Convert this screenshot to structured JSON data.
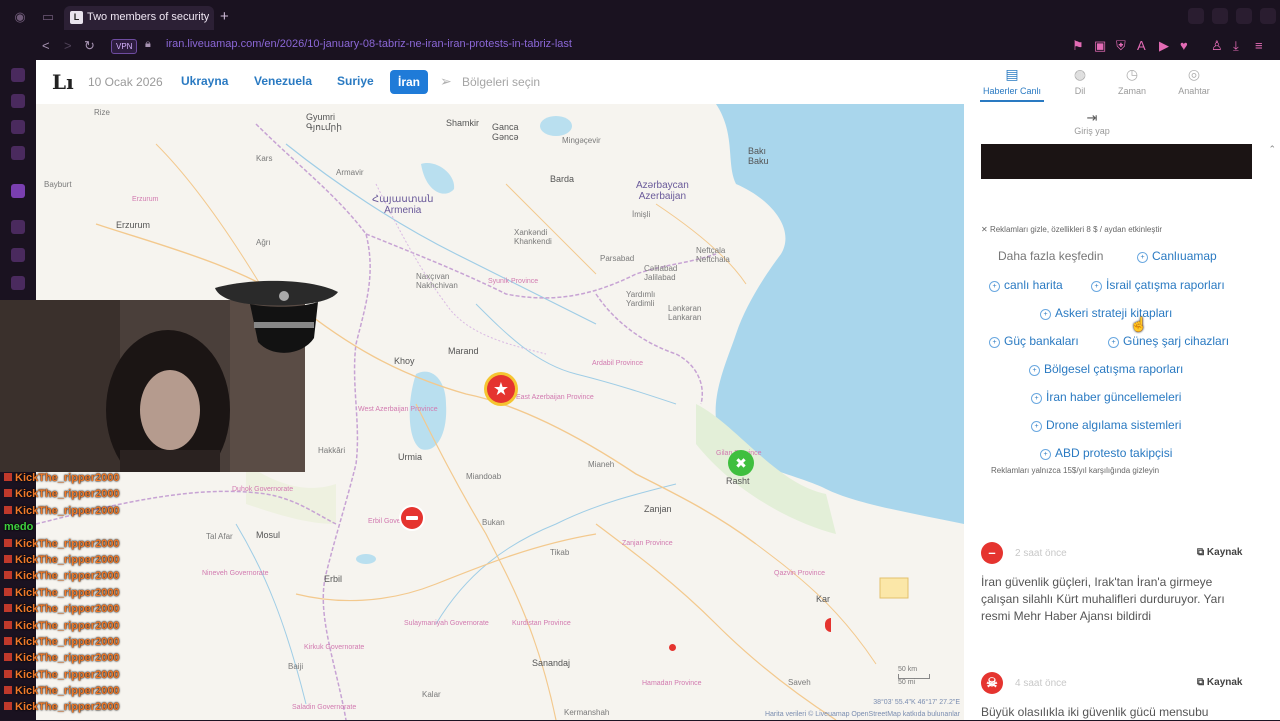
{
  "browser": {
    "tab_title": "Two members of security",
    "new_tab": "+",
    "vpn_label": "VPN",
    "url": "iran.liveuamap.com/en/2026/10-january-08-tabriz-ne-iran-iran-protests-in-tabriz-last"
  },
  "site": {
    "logo": "Lı",
    "date": "10 Ocak 2026",
    "nav": [
      "Ukrayna",
      "Venezuela",
      "Suriye"
    ],
    "nav_active": "İran",
    "region_select": "Bölgeleri seçin"
  },
  "map": {
    "labels": {
      "rize": "Rize",
      "gyumri": "Gyumri\nԳյումրի",
      "shamkir": "Shamkir",
      "ganca": "Ganca\nGəncə",
      "mingachevir": "Mingəçevir",
      "kars": "Kars",
      "baku": "Bakı\nBaku",
      "armavir": "Armavir",
      "armenia": "Հայաստան\nArmenia",
      "barda": "Barda",
      "azerbaijan": "Azərbaycan\nAzerbaijan",
      "bayburt": "Bayburt",
      "erzurum_p": "Erzurum",
      "erzurum": "Erzurum",
      "imisli": "İmişli",
      "agri": "Ağrı",
      "xankendi": "Xankəndi\nKhankendi",
      "nakhchivan": "Naxçıvan\nNakhchivan",
      "parsabad": "Parsabad",
      "celilabad": "Cəlilabad\nJalilabad",
      "neftcala": "Neftçala\nNeftchala",
      "syunik": "Syunik Province",
      "lankaran": "Lənkəran\nLankaran",
      "yardimli": "Yardımlı\nYardimli",
      "marand": "Marand",
      "khoy": "Khoy",
      "ardabil": "Ardabil Province",
      "east_az": "East Azerbaijan Province",
      "west_az": "West Azerbaijan Province",
      "urmia": "Urmia",
      "hakkari": "Hakkâri",
      "gilan": "Gilan Province",
      "rasht": "Rasht",
      "mianeh": "Mianeh",
      "miandoab": "Miandoab",
      "zanjan": "Zanjan",
      "zanjan_p": "Zanjan Province",
      "duhok": "Duhok Governorate",
      "erbil_g": "Erbil Governorate",
      "mosul": "Mosul",
      "talafar": "Tal Afar",
      "bukan": "Bukan",
      "takab": "Tikab",
      "erbil": "Erbil",
      "nineveh": "Nineveh Governorate",
      "qazvin": "Qazvin Province",
      "kurdistan": "Kurdistan Province",
      "sulaymaniyah": "Sulaymaniyah Governorate",
      "kirkuk": "Kirkuk Governorate",
      "sanandaj": "Sanandaj",
      "hamadan": "Hamadan Province",
      "saveh": "Saveh",
      "baiji": "Baiji",
      "kalar": "Kalar",
      "saladin": "Saladin Governorate",
      "kermanshah": "Kermanshah",
      "ka": "Kar",
      "scale_km": "50 km",
      "scale_mi": "50 mi",
      "coords": "38°03' 55.4\"K 46°17' 27.2\"E",
      "attribution": "Harita verileri © Liveuamap OpenStreetMap katkıda bulunanlar"
    }
  },
  "panel": {
    "tabs": [
      {
        "label": "Haberler Canlı",
        "icon": "news-icon"
      },
      {
        "label": "Dil",
        "icon": "globe-icon"
      },
      {
        "label": "Zaman",
        "icon": "clock-icon"
      },
      {
        "label": "Anahtar",
        "icon": "compass-icon"
      }
    ],
    "login": "Giriş yap",
    "ad_hide": "Reklamları gizle, özellikleri 8 $ / aydan etkinleştir",
    "ad_heading": "Daha fazla keşfedin",
    "ad_links": [
      "Canlıuamap",
      "canlı harita",
      "İsrail çatışma raporları",
      "Askeri strateji kitapları",
      "Güç bankaları",
      "Güneş şarj cihazları",
      "Bölgesel çatışma raporları",
      "İran haber güncellemeleri",
      "Drone algılama sistemleri",
      "ABD protesto takipçisi"
    ],
    "ad_footer": "Reklamları yalnızca 15$/yıl karşılığında gizleyin",
    "news": [
      {
        "time": "2 saat önce",
        "source": "Kaynak",
        "text": "İran güvenlik güçleri, Irak'tan İran'a girmeye çalışan silahlı Kürt muhalifleri durduruyor. Yarı resmi Mehr Haber Ajansı bildirdi"
      },
      {
        "time": "4 saat önce",
        "source": "Kaynak",
        "text": "Büyük olasılıkla iki güvenlik gücü mensubu"
      }
    ]
  },
  "chat": {
    "lines": [
      "KickThe_ripper2000",
      "KickThe_ripper2000",
      "KickThe_ripper2000",
      "medo",
      "KickThe_ripper2000",
      "KickThe_ripper2000",
      "KickThe_ripper2000",
      "KickThe_ripper2000",
      "KickThe_ripper2000",
      "KickThe_ripper2000",
      "KickThe_ripper2000",
      "KickThe_ripper2000",
      "KickThe_ripper2000",
      "KickThe_ripper2000",
      "KickThe_ripper2000"
    ]
  },
  "colors": {
    "accent": "#1f7bd8",
    "marker_red": "#e5342f",
    "marker_green": "#3fbf3f",
    "chat_orange": "#f07a2a"
  }
}
